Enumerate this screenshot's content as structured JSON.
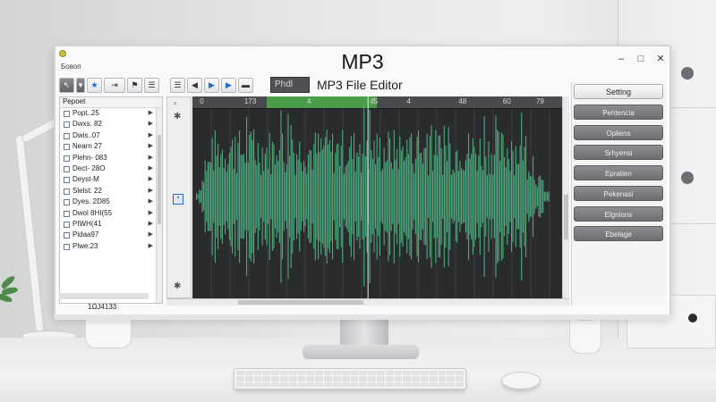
{
  "window": {
    "title": "MP3",
    "menu_label": "Бовоп",
    "controls": [
      "–",
      "□",
      "✕"
    ]
  },
  "toolbar": {
    "editor_label": "MP3 File Editor",
    "field_value": "Phdl",
    "left_icons": [
      "cursor-icon",
      "dropdown-icon",
      "pin-icon",
      "swap-icon",
      "flag-icon",
      "list-icon"
    ],
    "main_icons": [
      "menu-icon",
      "back-icon",
      "play-icon",
      "play-next-icon",
      "folder-icon"
    ]
  },
  "file_panel": {
    "header": "Pepoet",
    "items": [
      "Popt..25",
      "Dwxs. 82",
      "Dwis..07",
      "Nearn 27",
      "Plehn- 083",
      "Dect- 28O",
      "Deyst-M",
      "Slelst: 22",
      "Dyes. 2D85",
      "Dwol 8HI(55",
      "PIWH(41",
      "Pidaa97",
      "Plwe:23"
    ],
    "footer": "1ΩJ4133"
  },
  "waveform": {
    "ruler_ticks": [
      "0",
      "173",
      "4",
      "45",
      "4",
      "48",
      "60",
      "79"
    ],
    "selection_percent": [
      20,
      50
    ],
    "playhead_percent": 47.5,
    "wave_color_start": "#3c9c8f",
    "wave_color_end": "#57b86c"
  },
  "settings": {
    "top_button": "Settlng",
    "buttons": [
      "Pehtencia",
      "Opliens",
      "Srhyensi",
      "Epratien",
      "Pekenasi",
      "Elgnions",
      "Ebelage"
    ]
  }
}
